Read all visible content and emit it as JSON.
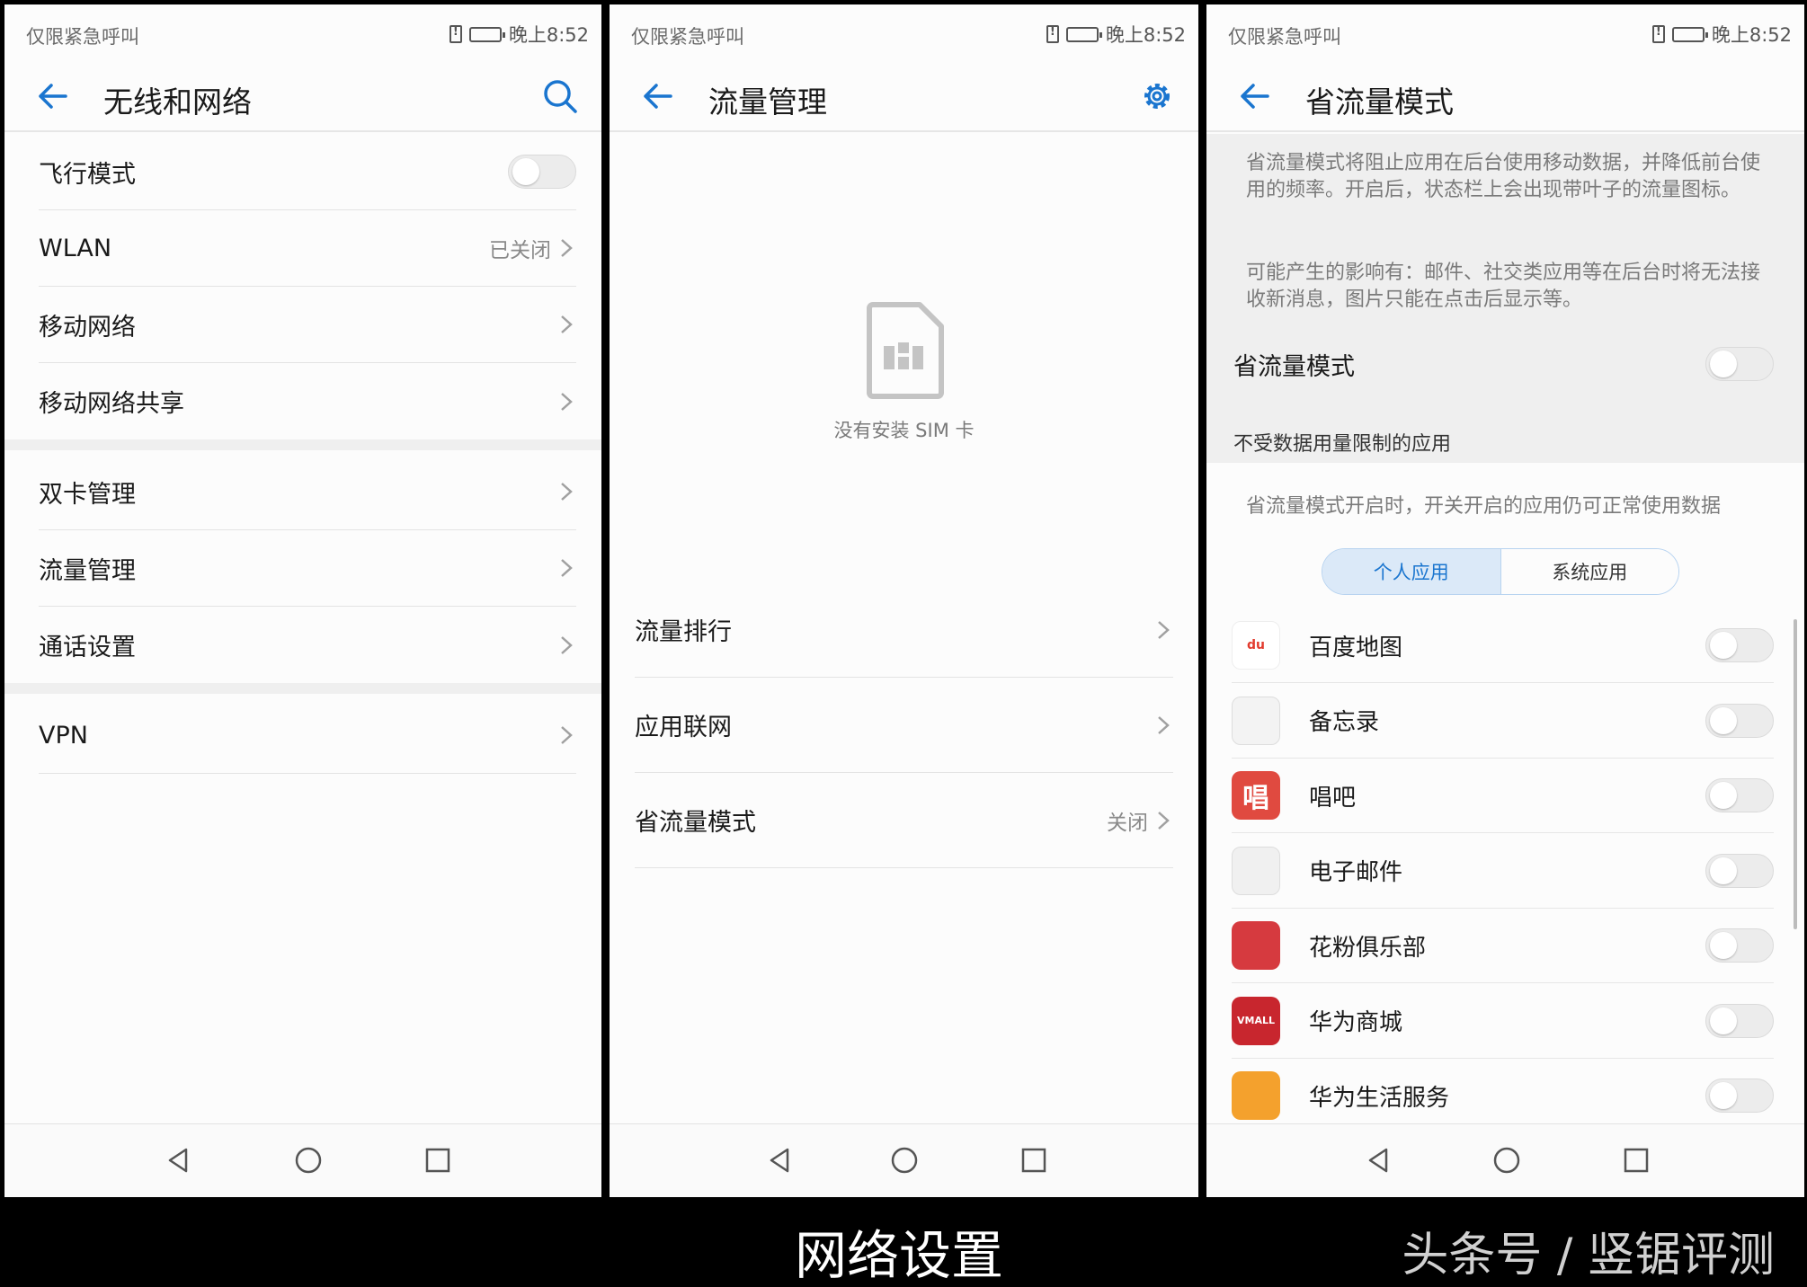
{
  "status": {
    "carrier": "仅限紧急呼叫",
    "time": "晚上8:52"
  },
  "screen1": {
    "title": "无线和网络",
    "items": [
      {
        "label": "飞行模式",
        "value": ""
      },
      {
        "label": "WLAN",
        "value": "已关闭"
      },
      {
        "label": "移动网络",
        "value": ""
      },
      {
        "label": "移动网络共享",
        "value": ""
      },
      {
        "label": "双卡管理",
        "value": ""
      },
      {
        "label": "流量管理",
        "value": ""
      },
      {
        "label": "通话设置",
        "value": ""
      },
      {
        "label": "VPN",
        "value": ""
      }
    ]
  },
  "screen2": {
    "title": "流量管理",
    "empty_text": "没有安装 SIM 卡",
    "items": [
      {
        "label": "流量排行",
        "value": ""
      },
      {
        "label": "应用联网",
        "value": ""
      },
      {
        "label": "省流量模式",
        "value": "关闭"
      }
    ]
  },
  "screen3": {
    "title": "省流量模式",
    "desc1": "省流量模式将阻止应用在后台使用移动数据，并降低前台使用的频率。开启后，状态栏上会出现带叶子的流量图标。",
    "desc2": "可能产生的影响有：邮件、社交类应用等在后台时将无法接收新消息，图片只能在点击后显示等。",
    "toggle_label": "省流量模式",
    "section_title": "不受数据用量限制的应用",
    "hint": "省流量模式开启时，开关开启的应用仍可正常使用数据",
    "tabs": [
      "个人应用",
      "系统应用"
    ],
    "apps": [
      {
        "name": "百度地图",
        "icon": "baidu-map-icon",
        "icon_text": "du",
        "color": "#ffffff"
      },
      {
        "name": "备忘录",
        "icon": "memo-icon",
        "icon_text": "",
        "color": "#f3f3f3"
      },
      {
        "name": "唱吧",
        "icon": "changba-icon",
        "icon_text": "唱",
        "color": "#e04a40"
      },
      {
        "name": "电子邮件",
        "icon": "email-icon",
        "icon_text": "",
        "color": "#f0f0f0"
      },
      {
        "name": "花粉俱乐部",
        "icon": "huafen-icon",
        "icon_text": "",
        "color": "#d63a3f"
      },
      {
        "name": "华为商城",
        "icon": "vmall-icon",
        "icon_text": "VMALL",
        "color": "#c8262e"
      },
      {
        "name": "华为生活服务",
        "icon": "life-service-icon",
        "icon_text": "",
        "color": "#f4a12d"
      }
    ]
  },
  "caption": {
    "title": "网络设置",
    "source": "头条号 / 竖锯评测"
  },
  "colors": {
    "accent": "#1a75cf",
    "background": "#fcfcfc"
  }
}
